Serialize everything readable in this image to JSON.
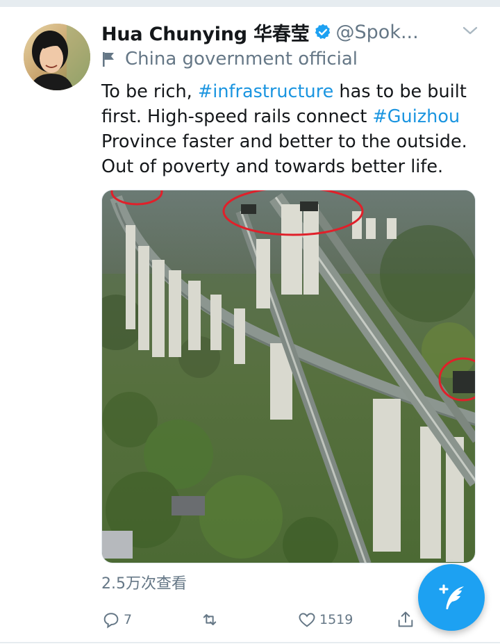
{
  "tweet": {
    "display_name": "Hua Chunying 华春莹",
    "handle": "@Spok...",
    "label": "China government official",
    "text_parts": [
      {
        "type": "text",
        "value": "To be rich, "
      },
      {
        "type": "hashtag",
        "value": "#infrastructure"
      },
      {
        "type": "text",
        "value": " has to be built first. High-speed rails connect "
      },
      {
        "type": "hashtag",
        "value": "#Guizhou"
      },
      {
        "type": "text",
        "value": " Province faster and better to the outside. Out of poverty and towards better life."
      }
    ],
    "views": "2.5万次查看",
    "media_alt": "Aerial view of high-speed rail viaducts and tunnels in mountainous Guizhou",
    "actions": {
      "reply_count": "7",
      "retweet_count": "",
      "like_count": "1519"
    }
  },
  "icons": {
    "verified": "verified-badge-icon",
    "more": "chevron-down-icon",
    "label": "flag-icon",
    "reply": "reply-icon",
    "retweet": "retweet-icon",
    "like": "heart-icon",
    "share": "share-icon",
    "compose": "compose-tweet-icon"
  },
  "colors": {
    "brand": "#1da1f2",
    "hashtag": "#1b95e0",
    "secondary_text": "#657786",
    "primary_text": "#14171a",
    "annotation_circle": "#e0202a"
  }
}
